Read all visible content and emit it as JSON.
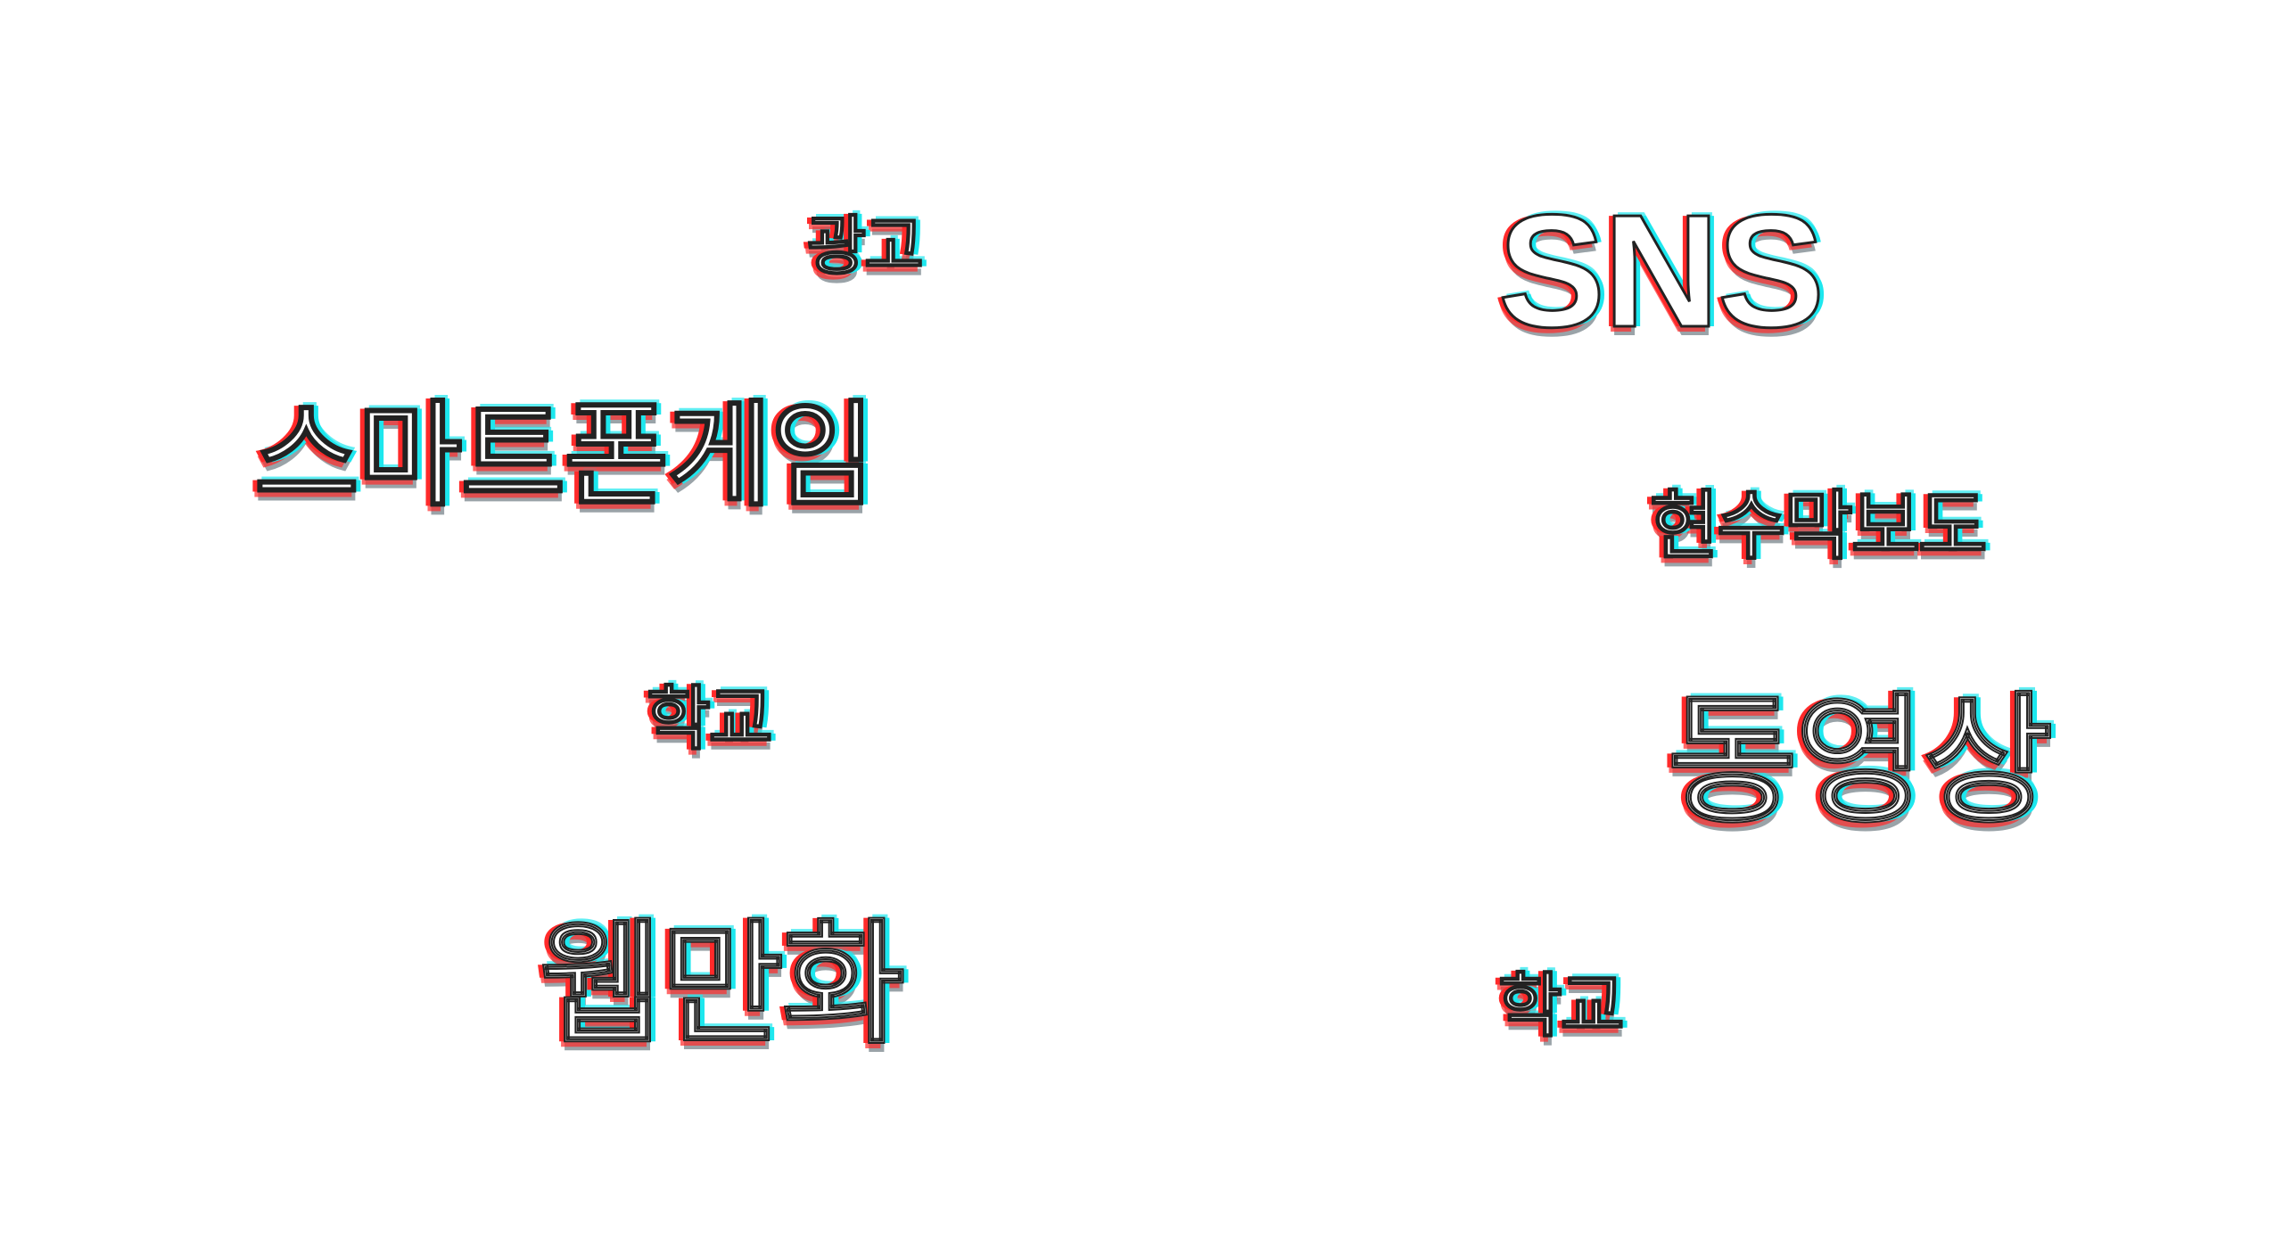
{
  "words": {
    "ad": "광고",
    "sns": "SNS",
    "smartphone_game": "스마트폰게임",
    "banner": "현수막보도",
    "school_1": "학교",
    "video": "동영상",
    "webtoon": "웹만화",
    "school_2": "학교"
  },
  "colors": {
    "background": "#ffffff",
    "glitch_red": "#ff2a2a",
    "glitch_cyan": "#1de7ee",
    "outline": "#222222",
    "shadow_gray": "#9aa3a8"
  }
}
